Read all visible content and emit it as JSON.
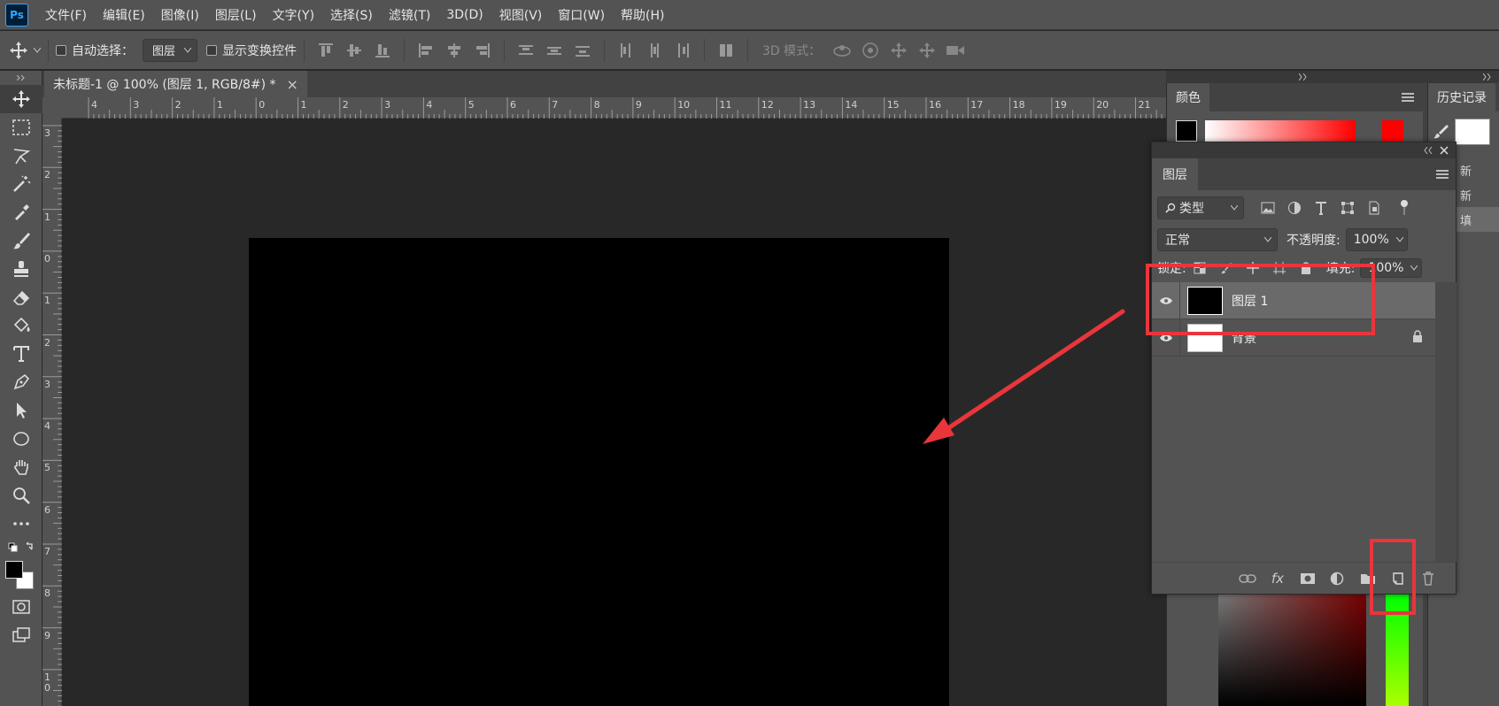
{
  "app": {
    "logo": "Ps"
  },
  "menu": [
    "文件(F)",
    "编辑(E)",
    "图像(I)",
    "图层(L)",
    "文字(Y)",
    "选择(S)",
    "滤镜(T)",
    "3D(D)",
    "视图(V)",
    "窗口(W)",
    "帮助(H)"
  ],
  "options": {
    "auto_select_label": "自动选择：",
    "auto_select_value": "图层",
    "show_transform_label": "显示变换控件",
    "mode_3d_label": "3D 模式："
  },
  "document": {
    "tab_title": "未标题-1 @ 100% (图层 1, RGB/8#) *",
    "close_glyph": "×"
  },
  "rulers": {
    "top": [
      "4",
      "3",
      "2",
      "1",
      "0",
      "1",
      "2",
      "3",
      "4",
      "5",
      "6",
      "7",
      "8",
      "9",
      "10",
      "11",
      "12",
      "13",
      "14",
      "15",
      "16",
      "17",
      "18",
      "19",
      "20",
      "21"
    ],
    "left": [
      "3",
      "2",
      "1",
      "0",
      "1",
      "2",
      "3",
      "4",
      "5",
      "6",
      "7",
      "8",
      "9",
      "1\n0"
    ]
  },
  "panels": {
    "color_tab": "颜色",
    "history_tab": "历史记录",
    "history_items": [
      "新",
      "新",
      "填"
    ],
    "layers_tab": "图层",
    "filter_kind": "类型",
    "blend_mode": "正常",
    "opacity_label": "不透明度:",
    "opacity_value": "100%",
    "lock_label": "锁定:",
    "fill_label": "填充:",
    "fill_value": "100%",
    "layers": [
      {
        "name": "图层 1",
        "thumb_color": "#000000",
        "selected": true
      },
      {
        "name": "背景",
        "thumb_color": "#ffffff",
        "selected": false,
        "locked": true
      }
    ],
    "footer_fx": "fx"
  },
  "colors": {
    "annotation_red": "#e8363b",
    "foreground": "#000000",
    "background": "#ffffff"
  }
}
